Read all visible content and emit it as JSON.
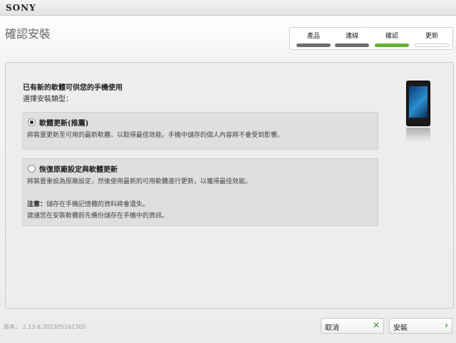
{
  "titlebar": {
    "brand": "SONY"
  },
  "page": {
    "title": "確認安裝"
  },
  "steps": [
    {
      "label": "產品",
      "state": "done"
    },
    {
      "label": "連線",
      "state": "done"
    },
    {
      "label": "確認",
      "state": "active"
    },
    {
      "label": "更新",
      "state": "pending"
    }
  ],
  "main": {
    "heading": "已有新的軟體可供您的手機使用",
    "subheading": "選擇安裝類型：",
    "option1": {
      "selected": true,
      "title": "軟體更新(推薦)",
      "description": "將裝置更新至可用的最新軟體，以取得最佳效能。手機中儲存的個人內容將不會受到影響。"
    },
    "option2": {
      "selected": false,
      "title": "恢復原廠設定與軟體更新",
      "description": "將裝置重設為原廠設定，然後使用最新的可用軟體進行更新，以獲得最佳效能。",
      "note_label": "注意：",
      "note_text": "儲存在手機記憶體的資料將會遺失。",
      "note_line2": "建議您在安裝軟體前先備份儲存在手機中的資訊。"
    }
  },
  "footer": {
    "version": "版本：  2.13.6.201305161305",
    "cancel_label": "取消",
    "install_label": "安裝"
  },
  "colors": {
    "accent": "#61b42c",
    "step_done": "#6d6d6d"
  },
  "icons": {
    "cancel": "close-icon",
    "install": "chevron-right-icon",
    "device": "phone-image"
  }
}
